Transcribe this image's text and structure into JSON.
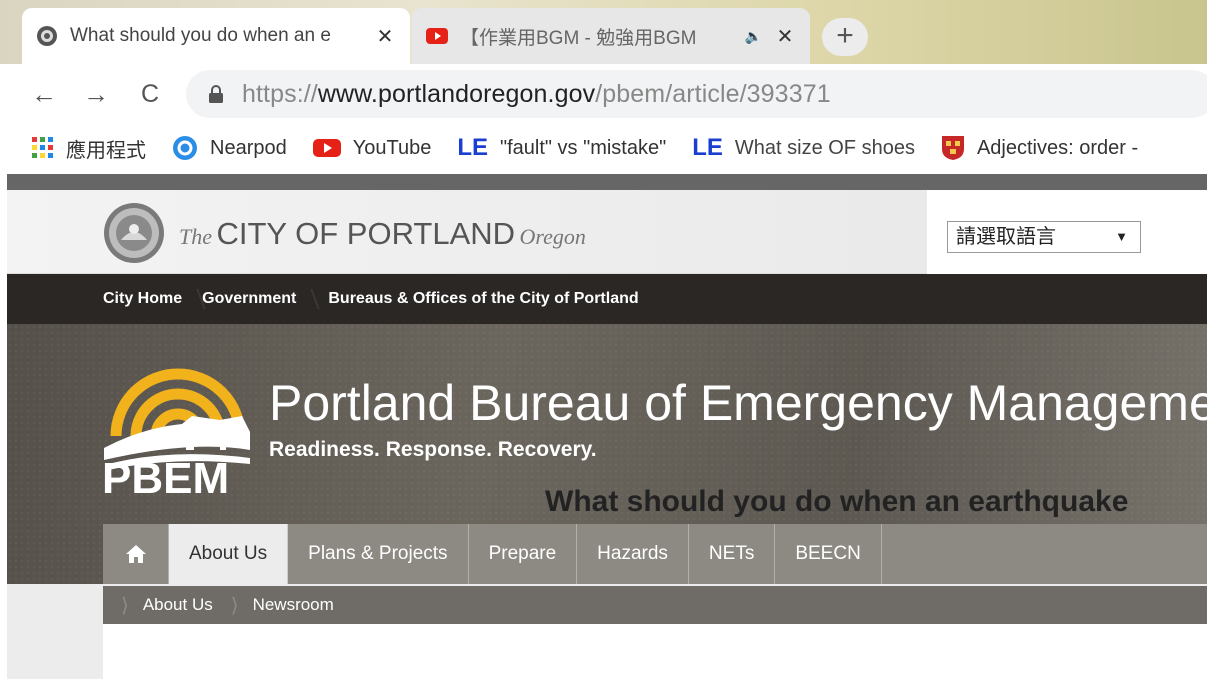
{
  "browser": {
    "tabs": [
      {
        "title": "What should you do when an e",
        "favicon": "globe-icon",
        "active": true
      },
      {
        "title": "【作業用BGM - 勉強用BGM",
        "favicon": "youtube-icon",
        "active": false,
        "audio": "🔈"
      }
    ],
    "new_tab_label": "+",
    "nav": {
      "back": "←",
      "forward": "→",
      "reload": "C"
    },
    "url": {
      "scheme": "https://",
      "host": "www.portlandoregon.gov",
      "path": "/pbem/article/393371"
    },
    "bookmarks": [
      {
        "label": "應用程式",
        "icon": "apps-grid-icon"
      },
      {
        "label": "Nearpod",
        "icon": "nearpod-icon"
      },
      {
        "label": "YouTube",
        "icon": "youtube-icon"
      },
      {
        "label": "\"fault\" vs \"mistake\"",
        "icon": "ue-icon"
      },
      {
        "label": "What size OF shoes",
        "icon": "ue-icon"
      },
      {
        "label": "Adjectives: order - ",
        "icon": "cambridge-icon"
      }
    ]
  },
  "site": {
    "city": {
      "the": "The",
      "main": "CITY OF PORTLAND",
      "state": "Oregon"
    },
    "language_select": {
      "value": "請選取語言",
      "arrow": "▼"
    },
    "breadcrumbs": [
      "City Home",
      "Government",
      "Bureaus & Offices of the City of Portland"
    ],
    "banner": {
      "logo_text": "PBEM",
      "title": "Portland Bureau of Emergency Management",
      "tagline": "Readiness. Response. Recovery."
    },
    "main_nav": [
      "About Us",
      "Plans & Projects",
      "Prepare",
      "Hazards",
      "NETs",
      "BEECN"
    ],
    "sub_nav": [
      "About Us",
      "Newsroom"
    ],
    "article_title": "What should you do when an earthquake"
  },
  "colors": {
    "crumbbar": "#2a2725",
    "banner": "#5f5a53",
    "nav": "#8d8983",
    "subnav": "#6f6b66",
    "logo_yellow": "#f2b21b"
  }
}
